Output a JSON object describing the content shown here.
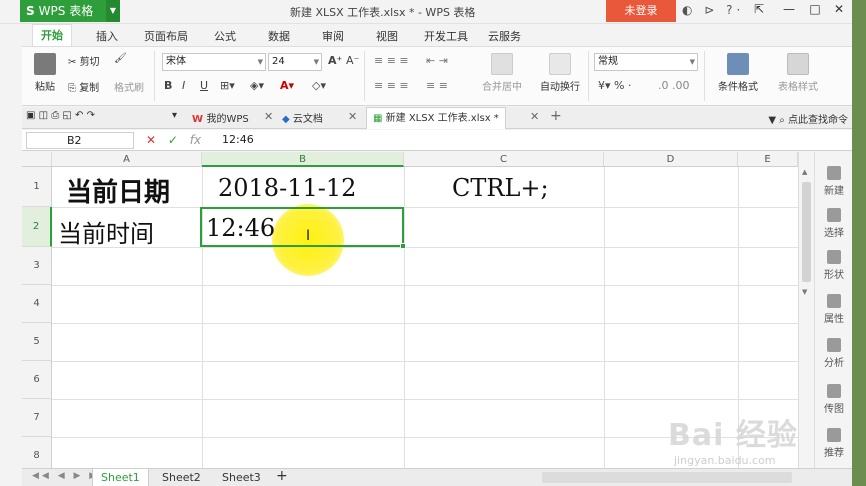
{
  "window": {
    "app_name": "WPS 表格",
    "title": "新建 XLSX 工作表.xlsx * - WPS 表格",
    "login_label": "未登录"
  },
  "menu": {
    "tabs": [
      "开始",
      "插入",
      "页面布局",
      "公式",
      "数据",
      "审阅",
      "视图",
      "开发工具",
      "云服务"
    ],
    "active": "开始"
  },
  "ribbon": {
    "paste": "粘贴",
    "cut": "剪切",
    "copy": "复制",
    "format_painter": "格式刷",
    "font_name": "宋体",
    "font_size": "24",
    "merge_center": "合并居中",
    "wrap_text": "自动换行",
    "number_format": "常规",
    "conditional_format": "条件格式",
    "table_style": "表格样式"
  },
  "doc_tabs": {
    "my_wps": "我的WPS",
    "cloud_docs": "云文档",
    "current_file": "新建 XLSX 工作表.xlsx *",
    "find_command": "点此查找命令"
  },
  "formula_bar": {
    "name_box": "B2",
    "content": "12:46"
  },
  "grid": {
    "columns": [
      "A",
      "B",
      "C",
      "D",
      "E"
    ],
    "rows": [
      "1",
      "2",
      "3",
      "4",
      "5",
      "6",
      "7",
      "8"
    ],
    "selected_cell": "B2",
    "cells": {
      "A1": "当前日期",
      "B1": "2018-11-12",
      "C1": "CTRL+;",
      "A2": "当前时间",
      "B2": "12:46"
    }
  },
  "task_panel": [
    "新建",
    "选择",
    "形状",
    "属性",
    "分析",
    "传图",
    "推荐"
  ],
  "sheet_tabs": {
    "tabs": [
      "Sheet1",
      "Sheet2",
      "Sheet3"
    ],
    "active": "Sheet1"
  },
  "watermark": {
    "logo": "Bai 经验",
    "url": "jingyan.baidu.com"
  },
  "colors": {
    "brand_green": "#2e9e3b",
    "login_orange": "#e9583b",
    "highlight_yellow": "#fff000"
  }
}
